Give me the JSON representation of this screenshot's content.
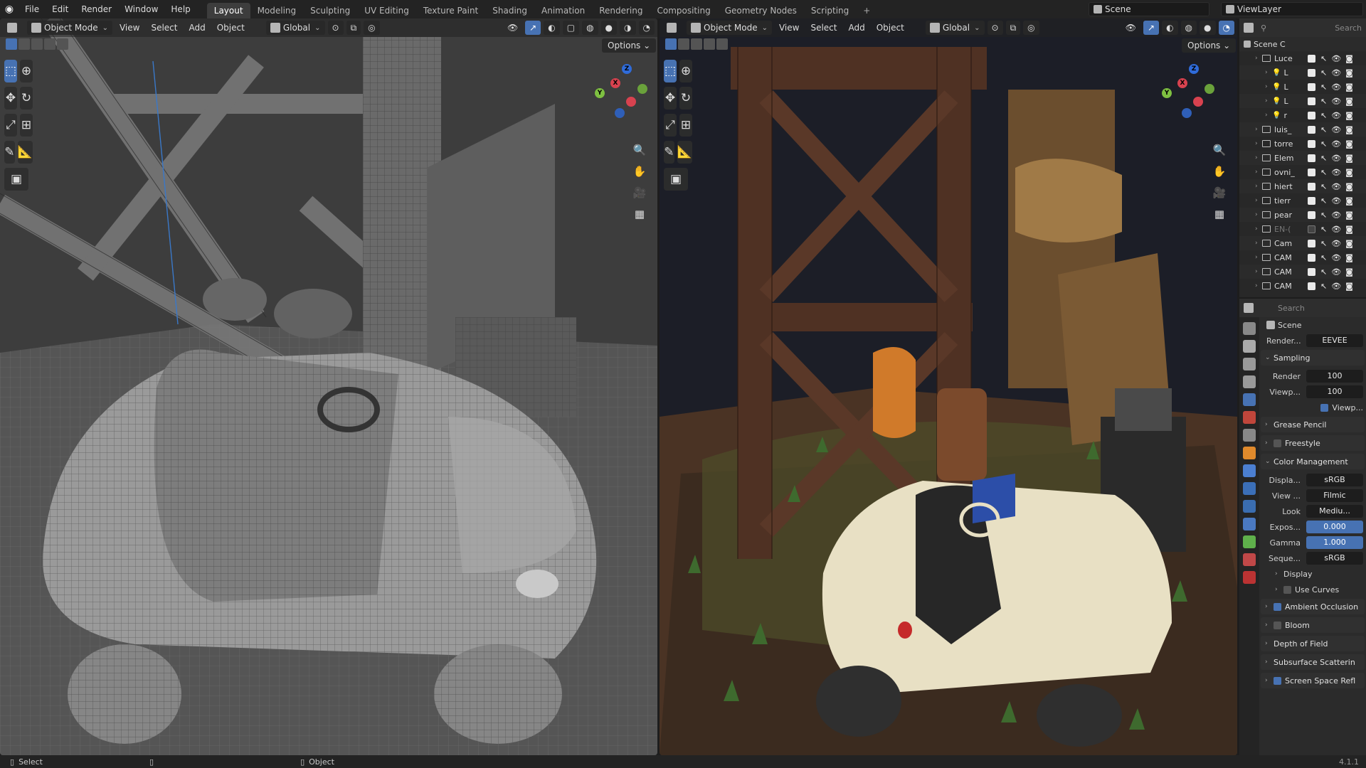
{
  "topbar": {
    "menu": [
      "File",
      "Edit",
      "Render",
      "Window",
      "Help"
    ],
    "workspaces": [
      "Layout",
      "Modeling",
      "Sculpting",
      "UV Editing",
      "Texture Paint",
      "Shading",
      "Animation",
      "Rendering",
      "Compositing",
      "Geometry Nodes",
      "Scripting"
    ],
    "active_workspace": "Layout",
    "scene_name": "Scene",
    "view_layer": "ViewLayer"
  },
  "viewport_left": {
    "mode": "Object Mode",
    "menus": [
      "View",
      "Select",
      "Add",
      "Object"
    ],
    "orientation": "Global",
    "options": "Options",
    "shading": "wireframe"
  },
  "viewport_right": {
    "mode": "Object Mode",
    "menus": [
      "View",
      "Select",
      "Add",
      "Object"
    ],
    "orientation": "Global",
    "options": "Options",
    "shading": "rendered"
  },
  "gizmo": {
    "x": "X",
    "y": "Y",
    "z": "Z"
  },
  "outliner": {
    "search_placeholder": "Search",
    "root": "Scene C",
    "items": [
      {
        "name": "Luce",
        "checked": true,
        "indent": 1,
        "type": "collection"
      },
      {
        "name": "L",
        "checked": true,
        "indent": 2,
        "type": "light"
      },
      {
        "name": "L",
        "checked": true,
        "indent": 2,
        "type": "light"
      },
      {
        "name": "L",
        "checked": true,
        "indent": 2,
        "type": "light"
      },
      {
        "name": "r",
        "checked": true,
        "indent": 2,
        "type": "light"
      },
      {
        "name": "luis_",
        "checked": true,
        "indent": 1,
        "type": "collection"
      },
      {
        "name": "torre",
        "checked": true,
        "indent": 1,
        "type": "collection"
      },
      {
        "name": "Elem",
        "checked": true,
        "indent": 1,
        "type": "collection"
      },
      {
        "name": "ovni_",
        "checked": true,
        "indent": 1,
        "type": "collection"
      },
      {
        "name": "hiert",
        "checked": true,
        "indent": 1,
        "type": "collection"
      },
      {
        "name": "tierr",
        "checked": true,
        "indent": 1,
        "type": "collection"
      },
      {
        "name": "pear",
        "checked": true,
        "indent": 1,
        "type": "collection"
      },
      {
        "name": "EN-(",
        "checked": false,
        "indent": 1,
        "type": "collection"
      },
      {
        "name": "Cam",
        "checked": true,
        "indent": 1,
        "type": "collection"
      },
      {
        "name": "CAM",
        "checked": true,
        "indent": 1,
        "type": "collection"
      },
      {
        "name": "CAM",
        "checked": true,
        "indent": 1,
        "type": "collection"
      },
      {
        "name": "CAM",
        "checked": true,
        "indent": 1,
        "type": "collection"
      }
    ]
  },
  "properties": {
    "search_placeholder": "Search",
    "context": "Scene",
    "render_engine_label": "Render...",
    "render_engine": "EEVEE",
    "sampling": {
      "title": "Sampling",
      "render_label": "Render",
      "render": "100",
      "viewport_label": "Viewp...",
      "viewport": "100",
      "denoise": "Viewp..."
    },
    "grease_pencil": "Grease Pencil",
    "freestyle": "Freestyle",
    "color_management": {
      "title": "Color Management",
      "display_label": "Displa...",
      "display": "sRGB",
      "view_label": "View ...",
      "view": "Filmic",
      "look_label": "Look",
      "look": "Mediu...",
      "exposure_label": "Expos...",
      "exposure": "0.000",
      "gamma_label": "Gamma",
      "gamma": "1.000",
      "sequencer_label": "Seque...",
      "sequencer": "sRGB",
      "display_sub": "Display",
      "use_curves": "Use Curves"
    },
    "ambient_occlusion": "Ambient Occlusion",
    "bloom": "Bloom",
    "depth_of_field": "Depth of Field",
    "subsurface": "Subsurface Scatterin",
    "ssr": "Screen Space Refl"
  },
  "statusbar": {
    "left": "Select",
    "mid": "Object",
    "version": "4.1.1"
  },
  "colors": {
    "accent": "#4772b3",
    "header": "#232323",
    "panel": "#2b2b2b"
  }
}
